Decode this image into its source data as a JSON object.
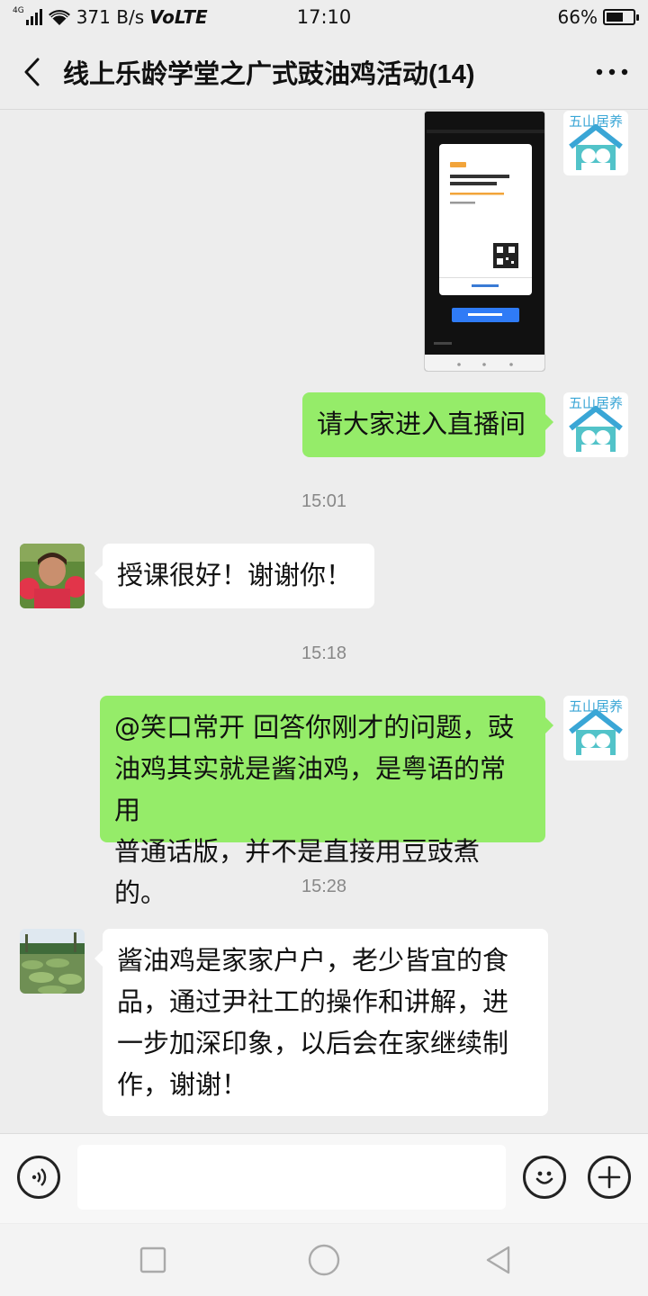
{
  "status_bar": {
    "network_tag": "4G",
    "speed": "371 B/s",
    "volte": "VoLTE",
    "time": "17:10",
    "battery": "66%",
    "battery_level": 0.66
  },
  "header": {
    "title": "线上乐龄学堂之广式豉油鸡活动(14)"
  },
  "avatars": {
    "self_logo_text": "五山居养"
  },
  "messages": {
    "shot": {
      "top_title": "五山街居养平台发起的直播",
      "card_title": "五山街居养平台发起的直播",
      "save_label": "保存到相册"
    },
    "m1": {
      "text": "请大家进入直播间"
    },
    "t1": "15:01",
    "m2": {
      "text": "授课很好！谢谢你！"
    },
    "t2": "15:18",
    "m3": {
      "lines": [
        "@笑口常开  回答你刚才的问题，豉",
        "油鸡其实就是酱油鸡，是粤语的常用",
        "普通话版，并不是直接用豆豉煮的。"
      ]
    },
    "t3": "15:28",
    "m4": {
      "lines": [
        "酱油鸡是家家户户，老少皆宜的食",
        "品，通过尹社工的操作和讲解，进",
        "一步加深印象，以后会在家继续制",
        "作，谢谢！"
      ]
    }
  },
  "input": {
    "value": ""
  },
  "icons": {
    "back": "chevron-left-icon",
    "more": "more-dots-icon",
    "voice": "voice-icon",
    "emoji": "emoji-icon",
    "plus": "plus-icon",
    "nav_recent": "square-icon",
    "nav_home": "circle-icon",
    "nav_back": "triangle-back-icon"
  },
  "colors": {
    "my_bubble": "#95ec69",
    "other_bubble": "#ffffff",
    "background": "#ededed",
    "logo_blue": "#3aa6d6",
    "logo_teal": "#52c3c9"
  }
}
